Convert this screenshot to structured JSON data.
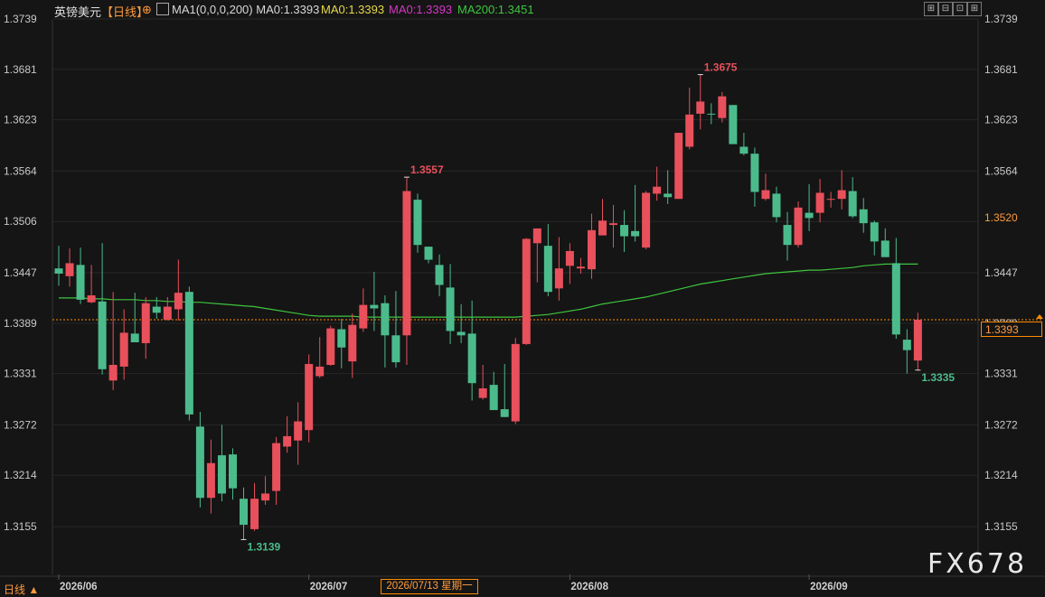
{
  "header": {
    "title": "英镑美元",
    "period": "【日线】",
    "crosshair_glyph": "⊕",
    "ma1_label": "MA1(0,0,0,200)",
    "ma1_value": "MA0:1.3393",
    "ma0_yellow": "MA0:1.3393",
    "ma0_magenta": "MA0:1.3393",
    "ma200": "MA200:1.3451",
    "toolbar": [
      "⊞",
      "⊟",
      "⊡",
      "⊞"
    ]
  },
  "price_boxes": {
    "current": "1.3393",
    "reference": "1.3520"
  },
  "footer": {
    "period_tab": "日线 ▲",
    "crosshair_date": "2026/07/13 星期一"
  },
  "watermark": "FX678",
  "colors": {
    "up": "#e8505b",
    "down": "#4cbb8c",
    "ma200": "#3ec53e",
    "accent": "#ff9b3d",
    "background": "#151515"
  },
  "chart_data": {
    "type": "candlestick",
    "title": "英镑美元",
    "ylim": [
      1.3118,
      1.376
    ],
    "y_ticks": [
      "1.3739",
      "1.3681",
      "1.3623",
      "1.3564",
      "1.3506",
      "1.3447",
      "1.3389",
      "1.3331",
      "1.3272",
      "1.3214",
      "1.3155"
    ],
    "x_ticks": [
      {
        "label": "2026/06",
        "index": 0
      },
      {
        "label": "2026/07",
        "index": 23
      },
      {
        "label": "2026/08",
        "index": 47
      },
      {
        "label": "2026/09",
        "index": 69
      }
    ],
    "candles": [
      {
        "o": 1.3452,
        "h": 1.3478,
        "l": 1.3432,
        "c": 1.3446
      },
      {
        "o": 1.3443,
        "h": 1.3475,
        "l": 1.3431,
        "c": 1.3458
      },
      {
        "o": 1.3456,
        "h": 1.3476,
        "l": 1.3411,
        "c": 1.3416
      },
      {
        "o": 1.3413,
        "h": 1.3456,
        "l": 1.3412,
        "c": 1.3421
      },
      {
        "o": 1.3414,
        "h": 1.3481,
        "l": 1.333,
        "c": 1.3336
      },
      {
        "o": 1.3323,
        "h": 1.3425,
        "l": 1.3312,
        "c": 1.3341
      },
      {
        "o": 1.3339,
        "h": 1.3405,
        "l": 1.3324,
        "c": 1.3378
      },
      {
        "o": 1.3377,
        "h": 1.3424,
        "l": 1.3367,
        "c": 1.3367
      },
      {
        "o": 1.3366,
        "h": 1.3419,
        "l": 1.3348,
        "c": 1.3412
      },
      {
        "o": 1.3408,
        "h": 1.3419,
        "l": 1.3394,
        "c": 1.3401
      },
      {
        "o": 1.3393,
        "h": 1.3419,
        "l": 1.3392,
        "c": 1.3408
      },
      {
        "o": 1.3405,
        "h": 1.3462,
        "l": 1.3392,
        "c": 1.3424
      },
      {
        "o": 1.3425,
        "h": 1.3431,
        "l": 1.3277,
        "c": 1.3284
      },
      {
        "o": 1.327,
        "h": 1.3287,
        "l": 1.3177,
        "c": 1.3188
      },
      {
        "o": 1.3188,
        "h": 1.3255,
        "l": 1.317,
        "c": 1.3228
      },
      {
        "o": 1.3237,
        "h": 1.3272,
        "l": 1.3184,
        "c": 1.3193
      },
      {
        "o": 1.3238,
        "h": 1.3245,
        "l": 1.3186,
        "c": 1.3199
      },
      {
        "o": 1.3187,
        "h": 1.32,
        "l": 1.314,
        "c": 1.3157
      },
      {
        "o": 1.3152,
        "h": 1.3205,
        "l": 1.315,
        "c": 1.3187
      },
      {
        "o": 1.3185,
        "h": 1.3213,
        "l": 1.318,
        "c": 1.3193
      },
      {
        "o": 1.3196,
        "h": 1.3258,
        "l": 1.318,
        "c": 1.3251
      },
      {
        "o": 1.3247,
        "h": 1.3282,
        "l": 1.324,
        "c": 1.3259
      },
      {
        "o": 1.3254,
        "h": 1.3298,
        "l": 1.3226,
        "c": 1.3276
      },
      {
        "o": 1.3266,
        "h": 1.3353,
        "l": 1.3252,
        "c": 1.3342
      },
      {
        "o": 1.3328,
        "h": 1.3373,
        "l": 1.3326,
        "c": 1.3339
      },
      {
        "o": 1.3341,
        "h": 1.3386,
        "l": 1.334,
        "c": 1.3383
      },
      {
        "o": 1.3382,
        "h": 1.3394,
        "l": 1.3337,
        "c": 1.3361
      },
      {
        "o": 1.3345,
        "h": 1.34,
        "l": 1.3326,
        "c": 1.3387
      },
      {
        "o": 1.3383,
        "h": 1.3429,
        "l": 1.3379,
        "c": 1.341
      },
      {
        "o": 1.341,
        "h": 1.3448,
        "l": 1.338,
        "c": 1.3406
      },
      {
        "o": 1.3412,
        "h": 1.3421,
        "l": 1.3338,
        "c": 1.3375
      },
      {
        "o": 1.3375,
        "h": 1.3426,
        "l": 1.3338,
        "c": 1.3344
      },
      {
        "o": 1.3375,
        "h": 1.3557,
        "l": 1.3341,
        "c": 1.3541
      },
      {
        "o": 1.3531,
        "h": 1.3538,
        "l": 1.347,
        "c": 1.3479
      },
      {
        "o": 1.3477,
        "h": 1.3475,
        "l": 1.3458,
        "c": 1.3462
      },
      {
        "o": 1.3456,
        "h": 1.3468,
        "l": 1.342,
        "c": 1.3433
      },
      {
        "o": 1.343,
        "h": 1.3457,
        "l": 1.3365,
        "c": 1.338
      },
      {
        "o": 1.3379,
        "h": 1.3411,
        "l": 1.3366,
        "c": 1.3375
      },
      {
        "o": 1.3377,
        "h": 1.3415,
        "l": 1.33,
        "c": 1.332
      },
      {
        "o": 1.3303,
        "h": 1.3341,
        "l": 1.3301,
        "c": 1.3314
      },
      {
        "o": 1.3318,
        "h": 1.3333,
        "l": 1.3294,
        "c": 1.3289
      },
      {
        "o": 1.329,
        "h": 1.3342,
        "l": 1.3282,
        "c": 1.3281
      },
      {
        "o": 1.3276,
        "h": 1.3372,
        "l": 1.3273,
        "c": 1.3365
      },
      {
        "o": 1.3365,
        "h": 1.3487,
        "l": 1.3364,
        "c": 1.3486
      },
      {
        "o": 1.3481,
        "h": 1.3498,
        "l": 1.3436,
        "c": 1.3498
      },
      {
        "o": 1.3478,
        "h": 1.3503,
        "l": 1.342,
        "c": 1.3425
      },
      {
        "o": 1.3429,
        "h": 1.3488,
        "l": 1.3415,
        "c": 1.3452
      },
      {
        "o": 1.3455,
        "h": 1.3481,
        "l": 1.3434,
        "c": 1.3472
      },
      {
        "o": 1.3452,
        "h": 1.3464,
        "l": 1.3446,
        "c": 1.3454
      },
      {
        "o": 1.3451,
        "h": 1.3515,
        "l": 1.344,
        "c": 1.3496
      },
      {
        "o": 1.349,
        "h": 1.3532,
        "l": 1.349,
        "c": 1.3507
      },
      {
        "o": 1.3502,
        "h": 1.3525,
        "l": 1.3476,
        "c": 1.3504
      },
      {
        "o": 1.3502,
        "h": 1.3519,
        "l": 1.3471,
        "c": 1.3489
      },
      {
        "o": 1.3495,
        "h": 1.3548,
        "l": 1.3483,
        "c": 1.3489
      },
      {
        "o": 1.3476,
        "h": 1.3541,
        "l": 1.3474,
        "c": 1.3539
      },
      {
        "o": 1.3538,
        "h": 1.3569,
        "l": 1.353,
        "c": 1.3546
      },
      {
        "o": 1.3538,
        "h": 1.3565,
        "l": 1.3526,
        "c": 1.3534
      },
      {
        "o": 1.3532,
        "h": 1.3598,
        "l": 1.3533,
        "c": 1.3608
      },
      {
        "o": 1.3592,
        "h": 1.366,
        "l": 1.3589,
        "c": 1.3629
      },
      {
        "o": 1.363,
        "h": 1.3675,
        "l": 1.3612,
        "c": 1.3644
      },
      {
        "o": 1.363,
        "h": 1.3642,
        "l": 1.3618,
        "c": 1.3629
      },
      {
        "o": 1.3625,
        "h": 1.3655,
        "l": 1.362,
        "c": 1.365
      },
      {
        "o": 1.364,
        "h": 1.3635,
        "l": 1.3595,
        "c": 1.3595
      },
      {
        "o": 1.3592,
        "h": 1.3608,
        "l": 1.3582,
        "c": 1.3584
      },
      {
        "o": 1.3584,
        "h": 1.3591,
        "l": 1.3523,
        "c": 1.354
      },
      {
        "o": 1.3532,
        "h": 1.3561,
        "l": 1.353,
        "c": 1.3542
      },
      {
        "o": 1.3538,
        "h": 1.3546,
        "l": 1.3505,
        "c": 1.3511
      },
      {
        "o": 1.3502,
        "h": 1.3517,
        "l": 1.3461,
        "c": 1.3479
      },
      {
        "o": 1.3479,
        "h": 1.3529,
        "l": 1.3476,
        "c": 1.3522
      },
      {
        "o": 1.3516,
        "h": 1.3549,
        "l": 1.3495,
        "c": 1.351
      },
      {
        "o": 1.3516,
        "h": 1.3555,
        "l": 1.3505,
        "c": 1.3539
      },
      {
        "o": 1.3532,
        "h": 1.354,
        "l": 1.3522,
        "c": 1.3532
      },
      {
        "o": 1.3532,
        "h": 1.3565,
        "l": 1.352,
        "c": 1.3542
      },
      {
        "o": 1.3541,
        "h": 1.3557,
        "l": 1.351,
        "c": 1.3512
      },
      {
        "o": 1.352,
        "h": 1.3533,
        "l": 1.3493,
        "c": 1.3504
      },
      {
        "o": 1.3505,
        "h": 1.3507,
        "l": 1.3467,
        "c": 1.3483
      },
      {
        "o": 1.3484,
        "h": 1.3498,
        "l": 1.3466,
        "c": 1.3465
      },
      {
        "o": 1.3458,
        "h": 1.3487,
        "l": 1.3371,
        "c": 1.3376
      },
      {
        "o": 1.337,
        "h": 1.3382,
        "l": 1.3331,
        "c": 1.3358
      },
      {
        "o": 1.3346,
        "h": 1.3401,
        "l": 1.3335,
        "c": 1.3393
      }
    ],
    "ma200": [
      1.3418,
      1.3418,
      1.3418,
      1.3417,
      1.3417,
      1.3416,
      1.3416,
      1.3416,
      1.3415,
      1.3415,
      1.3414,
      1.3414,
      1.3413,
      1.3413,
      1.3412,
      1.3411,
      1.341,
      1.3409,
      1.3408,
      1.3406,
      1.3404,
      1.3402,
      1.34,
      1.3398,
      1.3397,
      1.3397,
      1.3397,
      1.3397,
      1.3396,
      1.3396,
      1.3396,
      1.3396,
      1.3396,
      1.3396,
      1.3396,
      1.3396,
      1.3396,
      1.3396,
      1.3396,
      1.3396,
      1.3396,
      1.3396,
      1.3396,
      1.3397,
      1.3398,
      1.3399,
      1.3401,
      1.3403,
      1.3405,
      1.3408,
      1.3411,
      1.3413,
      1.3415,
      1.3417,
      1.3419,
      1.3422,
      1.3425,
      1.3428,
      1.3431,
      1.3434,
      1.3436,
      1.3438,
      1.344,
      1.3442,
      1.3444,
      1.3446,
      1.3447,
      1.3448,
      1.3449,
      1.345,
      1.345,
      1.3451,
      1.3452,
      1.3453,
      1.3455,
      1.3456,
      1.3457,
      1.3457,
      1.3457,
      1.3457
    ],
    "annotations": [
      {
        "label": "1.3557",
        "index": 32,
        "price": 1.3557,
        "kind": "high"
      },
      {
        "label": "1.3675",
        "index": 59,
        "price": 1.3675,
        "kind": "high"
      },
      {
        "label": "1.3139",
        "index": 17,
        "price": 1.314,
        "kind": "low"
      },
      {
        "label": "1.3335",
        "index": 79,
        "price": 1.3335,
        "kind": "low"
      }
    ],
    "reference_line": 1.3393
  }
}
